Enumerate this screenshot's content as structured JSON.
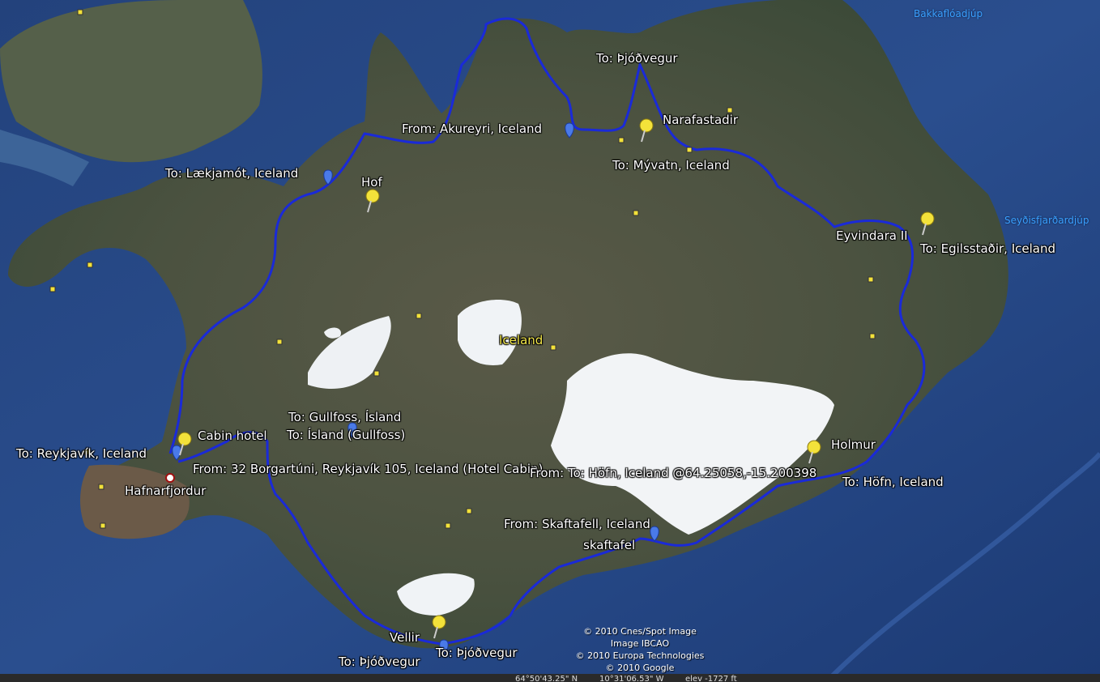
{
  "map": {
    "sea_labels": [
      "Bakkaflóadjúp",
      "Seyðisfjarðardjúp"
    ],
    "country_label": "Iceland",
    "route_color": "#1a2ad8",
    "labels": {
      "to_thjodvegur_north": "To: Þjóðvegur",
      "narafastadir": "Narafastadir",
      "from_akureyri": "From: Akureyri, Iceland",
      "to_myvatn": "To: Mývatn, Iceland",
      "to_laekjamot": "To: Lækjamót, Iceland",
      "hof": "Hof",
      "eyvindara": "Eyvindara II",
      "to_egilsstadir": "To: Egilsstaðir, Iceland",
      "to_gullfoss": "To: Gullfoss, Ísland",
      "to_island_gullfoss": "To: Ísland (Gullfoss)",
      "cabin_hotel": "Cabin hotel",
      "to_reykjavik": "To: Reykjavík, Iceland",
      "from_borgartuni": "From: 32 Borgartúni, Reykjavík 105, Iceland (Hotel Cabin)",
      "hafnarfjordur": "Hafnarfjordur",
      "holmur": "Holmur",
      "from_to_hofn": "From: To: Höfn, Iceland @64.25058,-15.200398",
      "to_hofn": "To: Höfn, Iceland",
      "from_skaftafell": "From: Skaftafell, Iceland",
      "skaftafel": "skaftafel",
      "vellir": "Vellir",
      "to_thjodvegur_south": "To: Þjóðvegur",
      "to_thjodvegur_sw": "To: Þjóðvegur"
    },
    "copyright": [
      "© 2010 Cnes/Spot Image",
      "Image IBCAO",
      "© 2010 Europa Technologies",
      "© 2010 Google"
    ],
    "status": {
      "lat": "64°50'43.25\" N",
      "lon": "10°31'06.53\" W",
      "elev": "elev -1727 ft"
    }
  }
}
